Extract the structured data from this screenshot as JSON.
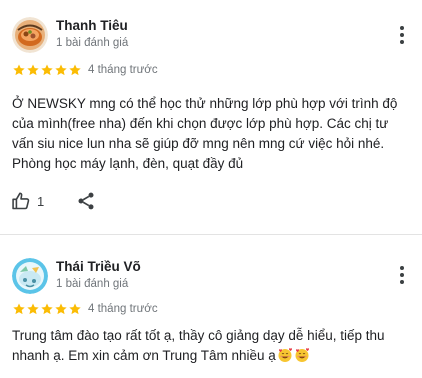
{
  "colors": {
    "star": "#fbbc04",
    "text": "#202124",
    "meta": "#70757a",
    "divider": "#e3e3e3"
  },
  "reviews": [
    {
      "author": "Thanh Tiêu",
      "author_meta": "1 bài đánh giá",
      "rating": 5,
      "time": "4 tháng trước",
      "text": "Ở NEWSKY mng có thể học thử những lớp phù hợp với trình độ của mình(free nha) đến khi chọn được lớp phù hợp. Các chị tư vấn siu nice lun nha sẽ giúp đỡ mng nên mng cứ việc hỏi nhé. Phòng học máy lạnh, đèn, quạt đầy đủ",
      "likes": "1",
      "icons": {
        "more": "more-vert-icon",
        "like": "thumb-up-icon",
        "share": "share-icon"
      }
    },
    {
      "author": "Thái Triều Võ",
      "author_meta": "1 bài đánh giá",
      "rating": 5,
      "time": "4 tháng trước",
      "text": "Trung tâm đào tạo rất tốt ạ, thầy cô giảng dạy dễ hiểu, tiếp thu nhanh ạ. Em xin cảm ơn Trung Tâm nhiều ạ",
      "emojis": [
        "smiling-face-with-hearts",
        "smiling-face-with-hearts"
      ],
      "icons": {
        "more": "more-vert-icon"
      }
    }
  ]
}
